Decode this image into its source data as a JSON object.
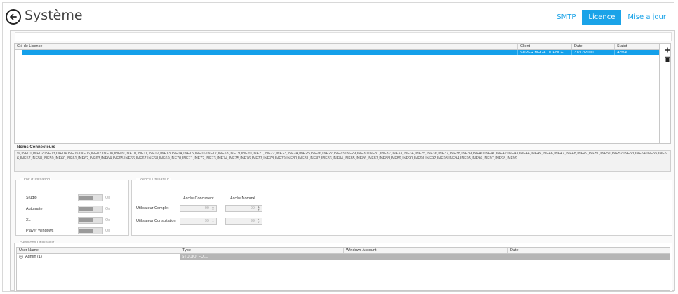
{
  "header": {
    "title": "Système",
    "nav": [
      {
        "label": "SMTP",
        "active": false
      },
      {
        "label": "Licence",
        "active": true
      },
      {
        "label": "Mise a jour",
        "active": false
      }
    ]
  },
  "license_grid": {
    "columns": [
      "Clé de Licence",
      "Client",
      "Date",
      "Statut"
    ],
    "rows": [
      {
        "key": "",
        "client": "SUPER MEGA LICENCE",
        "date": "31/12/2100",
        "status": "Active"
      }
    ]
  },
  "connecteurs": {
    "title": "Noms Connecteurs",
    "value": "%,INF01,INF02,INF03,INF04,INF05,INF06,INF07,INF08,INF09,INF10,INF11,INF12,INF13,INF14,INF15,INF16,INF17,INF18,INF19,INF20,INF21,INF22,INF23,INF24,INF25,INF26,INF27,INF28,INF29,INF30,INF31,INF32,INF33,INF34,INF35,INF36,INF37,INF38,INF39,INF40,INF41,INF42,INF43,INF44,INF45,INF46,INF47,INF48,INF49,INF50,INF51,INF52,INF53,INF54,INF55,INF56,INF57,INF58,INF59,INF60,INF61,INF62,INF63,INF64,INF65,INF66,INF67,INF68,INF69,INF70,INF71,INF72,INF73,INF74,INF75,INF76,INF77,INF78,INF79,INF80,INF81,INF82,INF83,INF84,INF85,INF86,INF87,INF88,INF89,INF90,INF91,INF92,INF93,INF94,INF95,INF96,INF97,INF98,INF99"
  },
  "droit": {
    "legend": "Droit d'utilisation",
    "items": [
      {
        "label": "Studio",
        "state": "On"
      },
      {
        "label": "Automate",
        "state": "On"
      },
      {
        "label": "XL",
        "state": "On"
      },
      {
        "label": "Player Windows",
        "state": "On"
      }
    ]
  },
  "licence_user": {
    "legend": "Licence Utilisateur",
    "col_concurrent": "Accès Concurrent",
    "col_nomme": "Accès Nommé",
    "rows": [
      {
        "label": "Utilisateur Complet",
        "concurrent": "99",
        "nomme": "99"
      },
      {
        "label": "Utilisateur Consultation",
        "concurrent": "99",
        "nomme": "99"
      }
    ]
  },
  "sessions": {
    "legend": "Sessions Utilisateur",
    "columns": [
      "User Name",
      "Type",
      "Windows Account",
      "Date"
    ],
    "rows": [
      {
        "user": "Admin (1)",
        "type": "STUDIO_FULL",
        "account": "",
        "date": ""
      }
    ]
  },
  "colors": {
    "accent": "#1aa3e8",
    "selected_row": "#14a0ea"
  },
  "icons": [
    "back-arrow-icon",
    "plus-icon",
    "trash-icon",
    "expand-icon"
  ]
}
